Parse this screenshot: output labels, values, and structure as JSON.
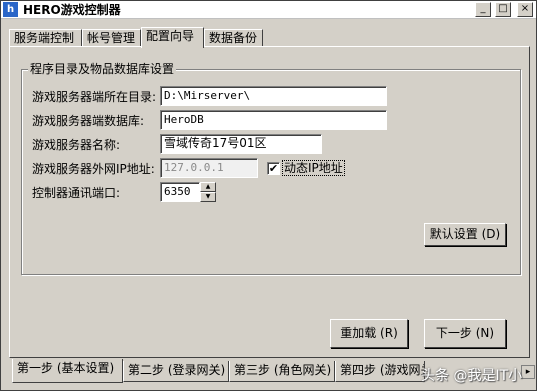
{
  "window": {
    "title": "HERO游戏控制器",
    "icon": "hero-app-icon",
    "min_label": "_",
    "max_label": "□",
    "close_label": "×"
  },
  "tabs": [
    {
      "label": "服务端控制",
      "active": false
    },
    {
      "label": "帐号管理",
      "active": false
    },
    {
      "label": "配置向导",
      "active": true
    },
    {
      "label": "数据备份",
      "active": false
    }
  ],
  "group": {
    "title": "程序目录及物品数据库设置",
    "server_dir": {
      "label": "游戏服务器端所在目录:",
      "value": "D:\\Mirserver\\"
    },
    "server_db": {
      "label": "游戏服务器端数据库:",
      "value": "HeroDB"
    },
    "server_name": {
      "label": "游戏服务器名称:",
      "value": "雪域传奇17号01区"
    },
    "server_ip": {
      "label": "游戏服务器外网IP地址:",
      "value": "127.0.0.1"
    },
    "dynamic_ip": {
      "label": "动态IP地址",
      "checked": true,
      "mark": "✔"
    },
    "port": {
      "label": "控制器通讯端口:",
      "value": "6350"
    },
    "default_button": "默认设置 (D)"
  },
  "actions": {
    "reload": "重加载 (R)",
    "next": "下一步 (N)"
  },
  "bottom_tabs": [
    {
      "label": "第一步 (基本设置)",
      "active": true
    },
    {
      "label": "第二步 (登录网关)",
      "active": false
    },
    {
      "label": "第三步 (角色网关)",
      "active": false
    },
    {
      "label": "第四步 (游戏网关",
      "active": false
    }
  ],
  "watermark": "头条 @我是IT小",
  "scroll_right": "▸"
}
